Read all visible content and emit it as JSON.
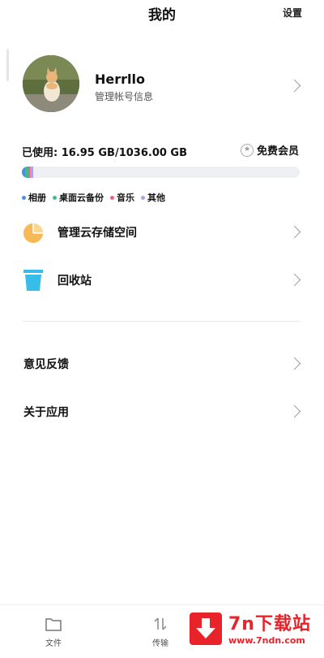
{
  "header": {
    "title": "我的",
    "settings": "设置"
  },
  "profile": {
    "username": "Herrllo",
    "subtitle": "管理帐号信息"
  },
  "storage": {
    "used_text": "已使用: 16.95 GB/1036.00 GB",
    "used_gb": 16.95,
    "total_gb": 1036.0,
    "vip_label": "免费会员",
    "segments": [
      {
        "name": "相册",
        "color": "#4a90e2",
        "fraction": 0.012
      },
      {
        "name": "桌面云备份",
        "color": "#3dbe8b",
        "fraction": 0.01
      },
      {
        "name": "音乐",
        "color": "#f0627e",
        "fraction": 0.006
      },
      {
        "name": "其他",
        "color": "#b79de8",
        "fraction": 0.012
      }
    ]
  },
  "menu": {
    "manage_storage": "管理云存储空间",
    "recycle": "回收站",
    "feedback": "意见反馈",
    "about": "关于应用"
  },
  "tabs": {
    "files": "文件",
    "transfer": "传输"
  },
  "watermark": {
    "title": "7n下载站",
    "url": "www.7ndn.com"
  },
  "colors": {
    "pie_icon": "#f7b955",
    "trash_icon": "#38bdea"
  }
}
